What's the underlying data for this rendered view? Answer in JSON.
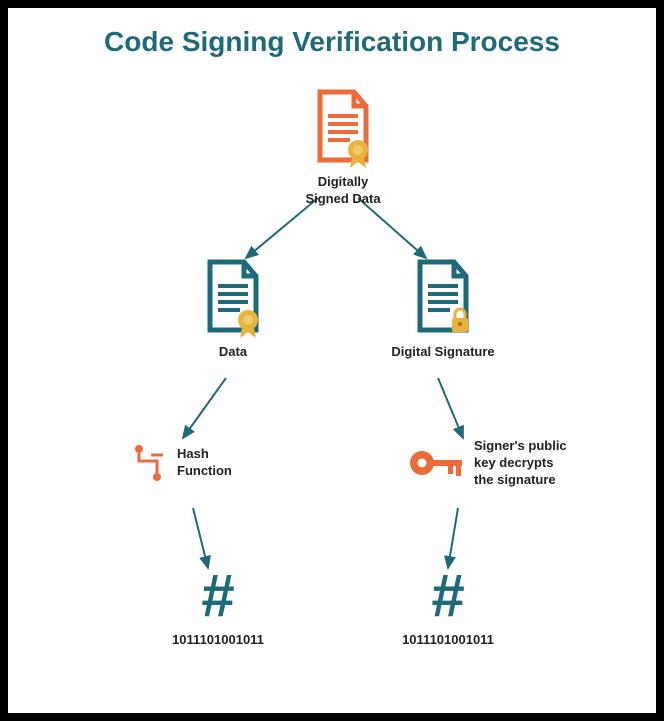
{
  "title": "Code Signing Verification Process",
  "nodes": {
    "top": {
      "label": "Digitally Signed Data"
    },
    "left_doc": {
      "label": "Data"
    },
    "right_doc": {
      "label": "Digital Signature"
    },
    "hash_fn": {
      "label": "Hash\nFunction"
    },
    "key": {
      "label": "Signer's public\nkey decrypts\nthe signature"
    },
    "left_hash": {
      "value": "1011101001011"
    },
    "right_hash": {
      "value": "1011101001011"
    }
  },
  "colors": {
    "teal": "#1e6a7a",
    "orange": "#ef6a3a",
    "gold": "#e8b33a"
  }
}
